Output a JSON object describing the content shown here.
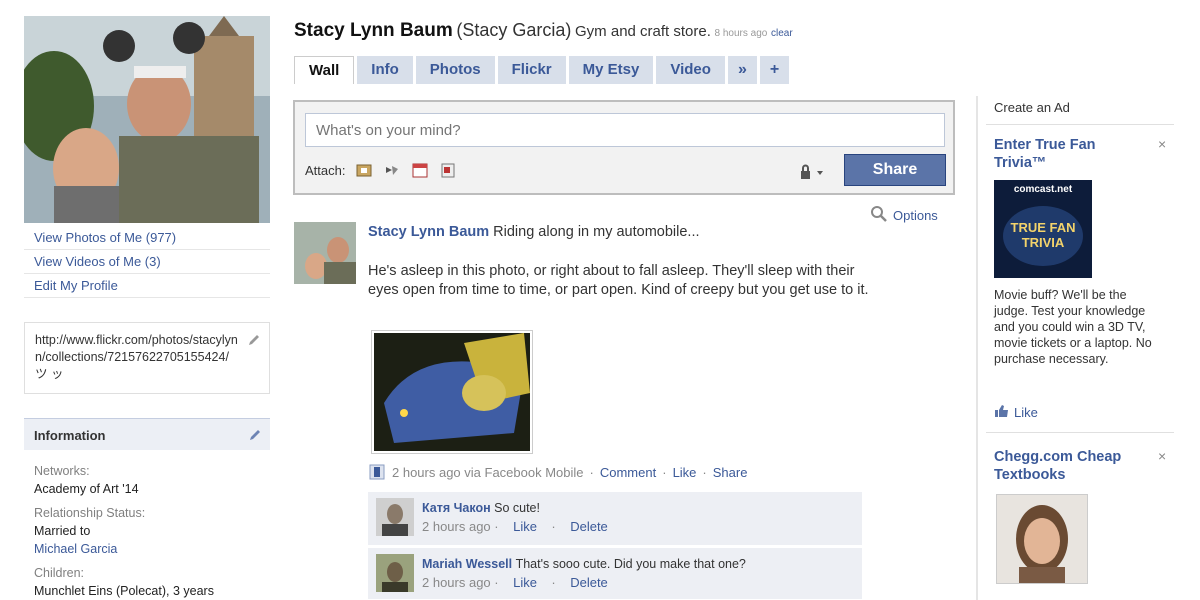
{
  "left": {
    "profile_links": [
      "View Photos of Me (977)",
      "View Videos of Me (3)",
      "Edit My Profile"
    ],
    "url_box": "http://www.flickr.com/photos/stacylynn/collections/72157622705155424/ ツ ッ",
    "info_title": "Information",
    "networks_label": "Networks:",
    "networks_value": "Academy of Art '14",
    "relationship_label": "Relationship Status:",
    "relationship_value": "Married to",
    "relationship_partner": "Michael Garcia",
    "children_label": "Children:",
    "children_value": "Munchlet Eins (Polecat), 3 years"
  },
  "header": {
    "name": "Stacy Lynn Baum",
    "alt_name": "(Stacy Garcia)",
    "status": "Gym and craft store.",
    "time": "8 hours ago",
    "clear": "clear"
  },
  "tabs": [
    "Wall",
    "Info",
    "Photos",
    "Flickr",
    "My Etsy",
    "Video"
  ],
  "tab_more": "»",
  "tab_add": "+",
  "publisher": {
    "placeholder": "What's on your mind?",
    "attach_label": "Attach:",
    "share_label": "Share"
  },
  "options_label": "Options",
  "story": {
    "actor": "Stacy Lynn Baum",
    "headline": "Riding along in my automobile...",
    "body": "He's asleep in this photo, or right about to fall asleep. They'll sleep with their eyes open from time to time, or part open. Kind of creepy but you get use to it.",
    "meta_time": "2 hours ago via Facebook Mobile",
    "meta_comment": "Comment",
    "meta_like": "Like",
    "meta_share": "Share",
    "sep": "·"
  },
  "comments": [
    {
      "name": "Катя Чакон",
      "text": "So cute!",
      "time": "2 hours ago",
      "like": "Like",
      "delete": "Delete"
    },
    {
      "name": "Mariah Wessell",
      "text": "That's sooo cute. Did you make that one?",
      "time": "2 hours ago",
      "like": "Like",
      "delete": "Delete"
    }
  ],
  "ads": {
    "create_ad": "Create an Ad",
    "ad1_title": "Enter True Fan Trivia™",
    "ad1_img_brand": "comcast.net",
    "ad1_img_line1": "TRUE FAN",
    "ad1_img_line2": "TRIVIA",
    "ad1_text": "Movie buff? We'll be the judge. Test your knowledge and you could win a 3D TV, movie tickets or a laptop. No purchase necessary.",
    "ad1_like": "Like",
    "ad2_title": "Chegg.com Cheap Textbooks",
    "close": "×"
  },
  "colors": {
    "facebook_blue": "#3b5998",
    "tab_bg": "#d8dfea",
    "share_button": "#5b74a8",
    "comment_bg": "#edeff4"
  }
}
